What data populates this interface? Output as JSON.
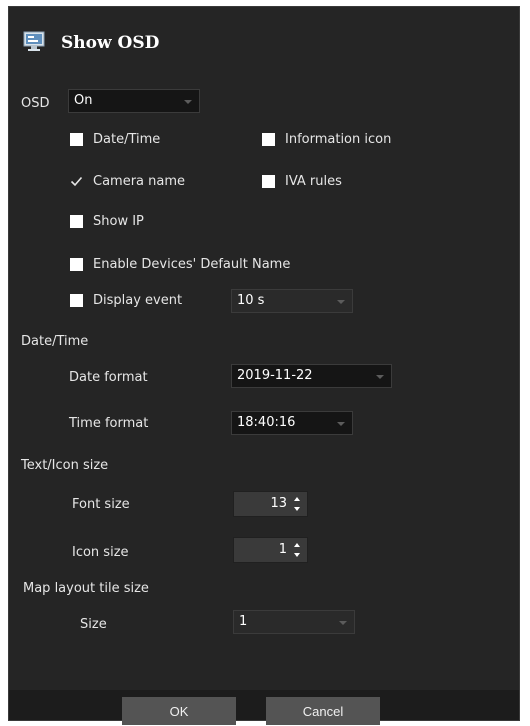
{
  "dialog": {
    "title": "Show OSD",
    "icon": "monitor-settings-icon"
  },
  "osd": {
    "label": "OSD",
    "value": "On"
  },
  "checkboxes": {
    "date_time": {
      "label": "Date/Time",
      "checked": false
    },
    "information_icon": {
      "label": "Information icon",
      "checked": false
    },
    "camera_name": {
      "label": "Camera name",
      "checked": true
    },
    "iva_rules": {
      "label": "IVA rules",
      "checked": false
    },
    "show_ip": {
      "label": "Show IP",
      "checked": false
    },
    "enable_default_name": {
      "label": "Enable Devices' Default Name",
      "checked": false
    },
    "display_event": {
      "label": "Display event",
      "checked": false
    }
  },
  "display_event_duration": "10 s",
  "date_time_section": {
    "heading": "Date/Time",
    "date_format_label": "Date format",
    "date_format_value": "2019-11-22",
    "time_format_label": "Time format",
    "time_format_value": "18:40:16"
  },
  "text_icon_section": {
    "heading": "Text/Icon size",
    "font_size_label": "Font size",
    "font_size_value": "13",
    "icon_size_label": "Icon size",
    "icon_size_value": "1"
  },
  "map_section": {
    "heading": "Map layout tile size",
    "size_label": "Size",
    "size_value": "1"
  },
  "buttons": {
    "ok": "OK",
    "cancel": "Cancel"
  },
  "colors": {
    "background": "#252525",
    "button": "#545454",
    "text": "#e6e6e6"
  }
}
